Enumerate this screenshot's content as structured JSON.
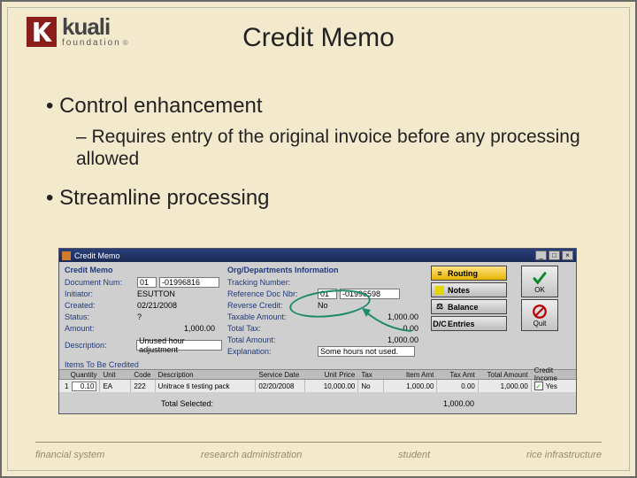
{
  "logo": {
    "main": "kuali",
    "sub": "foundation"
  },
  "title": "Credit Memo",
  "bullets": {
    "b1": "Control enhancement",
    "b1_sub": "– Requires entry of the original invoice before any processing allowed",
    "b2": "Streamline processing"
  },
  "app": {
    "window_title": "Credit Memo",
    "left_legend": "Credit Memo",
    "mid_legend": "Org/Departments Information",
    "fields_left": {
      "doc_num_label": "Document Num:",
      "doc_num_prefix": "01",
      "doc_num_value": "-01996816",
      "initiator_label": "Initiator:",
      "initiator_value": "ESUTTON",
      "created_label": "Created:",
      "created_value": "02/21/2008",
      "status_label": "Status:",
      "status_value": "?",
      "amount_label": "Amount:",
      "amount_value": "1,000.00",
      "desc_label": "Description:",
      "desc_value": "Unused hour adjustment"
    },
    "fields_mid": {
      "tracking_label": "Tracking Number:",
      "refdoc_label": "Reference Doc Nbr:",
      "refdoc_prefix": "01",
      "refdoc_value": "-01996598",
      "reverse_label": "Reverse Credit:",
      "reverse_value": "No",
      "taxable_label": "Taxable Amount:",
      "taxable_value": "1,000.00",
      "totaltax_label": "Total Tax:",
      "totaltax_value": "0.00",
      "totalamt_label": "Total Amount:",
      "totalamt_value": "1,000.00",
      "expl_label": "Explanation:",
      "expl_value": "Some hours not used."
    },
    "buttons": {
      "routing": "Routing",
      "notes": "Notes",
      "balance": "Balance",
      "entries": "Entries",
      "ok": "OK",
      "quit": "Quit"
    },
    "items_legend": "Items To Be Credited",
    "grid": {
      "headers": {
        "qty": "Quantity",
        "unit": "Unit",
        "code": "Code",
        "desc": "Description",
        "svc": "Service Date",
        "uprice": "Unit Price",
        "tax": "Tax",
        "itemamt": "Item Amt",
        "taxamt": "Tax Amt",
        "totalamt": "Total Amount",
        "credinc": "Credit Income"
      },
      "row": {
        "line": "1",
        "qty": "0.10",
        "unit": "EA",
        "code": "222",
        "desc": "Unitrace ti testing pack",
        "svc": "02/20/2008",
        "uprice": "10,000.00",
        "tax": "No",
        "itemamt": "1,000.00",
        "taxamt": "0.00",
        "totalamt": "1,000.00",
        "credinc": "Yes"
      }
    },
    "totals": {
      "label": "Total Selected:",
      "value": "1,000.00"
    }
  },
  "footer": {
    "a": "financial system",
    "b": "research administration",
    "c": "student",
    "d": "rice infrastructure"
  }
}
